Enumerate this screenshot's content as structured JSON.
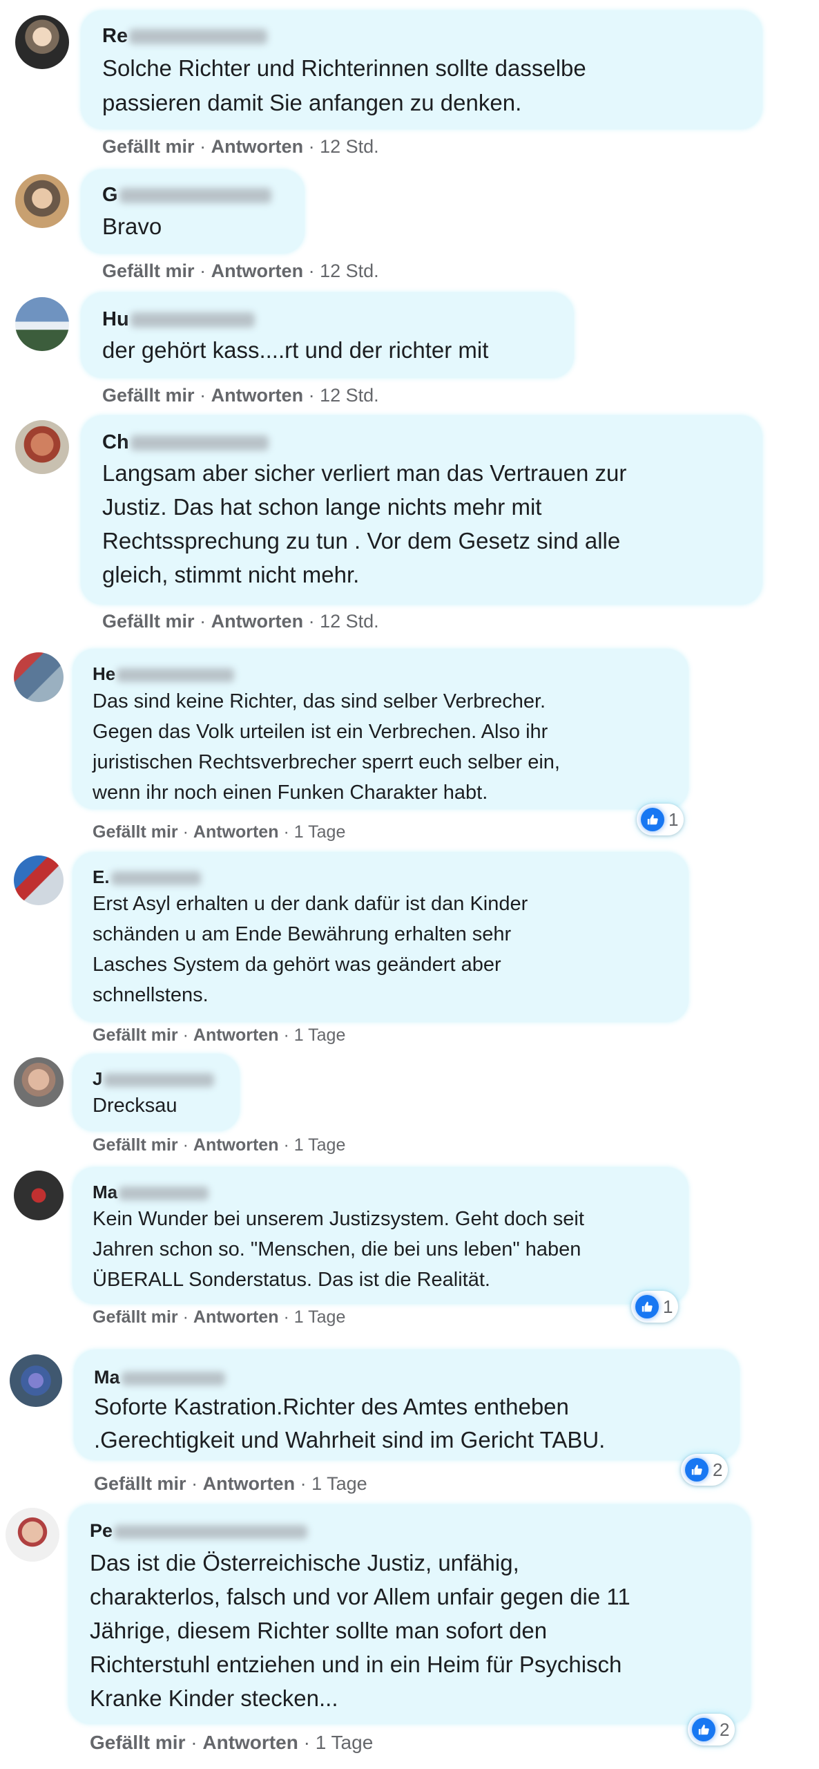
{
  "labels": {
    "like": "Gefällt mir",
    "reply": "Antworten",
    "sep": "·"
  },
  "colors": {
    "bubble": "#e4f8fd",
    "like_blue": "#1877f2",
    "meta_text": "#65676b"
  },
  "comments": [
    {
      "author_visible": "Re",
      "text": "Solche Richter und Richterinnen sollte dasselbe\npassieren damit Sie anfangen zu denken.",
      "time": "12 Std.",
      "likes": null
    },
    {
      "author_visible": "G",
      "text": "Bravo",
      "time": "12 Std.",
      "likes": null
    },
    {
      "author_visible": "Hu",
      "text": "der gehört kass....rt und der richter mit",
      "time": "12 Std.",
      "likes": null
    },
    {
      "author_visible": "Ch",
      "text": "Langsam aber sicher verliert man das Vertrauen zur\nJustiz. Das hat schon lange nichts mehr mit\nRechtssprechung zu tun . Vor dem Gesetz sind alle\ngleich, stimmt nicht mehr.",
      "time": "12 Std.",
      "likes": null
    },
    {
      "author_visible": "He",
      "text": "Das sind keine Richter, das sind selber Verbrecher.\nGegen das Volk urteilen ist ein Verbrechen. Also ihr\njuristischen Rechtsverbrecher sperrt euch selber ein,\nwenn ihr noch einen Funken Charakter habt.",
      "time": "1 Tage",
      "likes": "1"
    },
    {
      "author_visible": "E.",
      "text": "Erst Asyl erhalten u der dank dafür ist dan Kinder\nschänden u am Ende Bewährung erhalten sehr\nLasches System da gehört was geändert aber\nschnellstens.",
      "time": "1 Tage",
      "likes": null
    },
    {
      "author_visible": "J",
      "text": "Drecksau",
      "time": "1 Tage",
      "likes": null
    },
    {
      "author_visible": "Ma",
      "text": "Kein Wunder bei unserem Justizsystem. Geht doch seit\nJahren schon so. \"Menschen, die bei uns leben\" haben\nÜBERALL Sonderstatus. Das ist die Realität.",
      "time": "1 Tage",
      "likes": "1"
    },
    {
      "author_visible": "Ma",
      "text": "Soforte Kastration.Richter des Amtes entheben\n.Gerechtigkeit und Wahrheit sind im Gericht TABU.",
      "time": "1 Tage",
      "likes": "2"
    },
    {
      "author_visible": "Pe",
      "text": "Das ist die Österreichische Justiz, unfähig,\ncharakterlos, falsch und vor Allem unfair gegen die 11\nJährige, diesem Richter sollte man sofort den\nRichterstuhl entziehen und in ein Heim für Psychisch\nKranke Kinder stecken...",
      "time": "1 Tage",
      "likes": "2"
    }
  ]
}
